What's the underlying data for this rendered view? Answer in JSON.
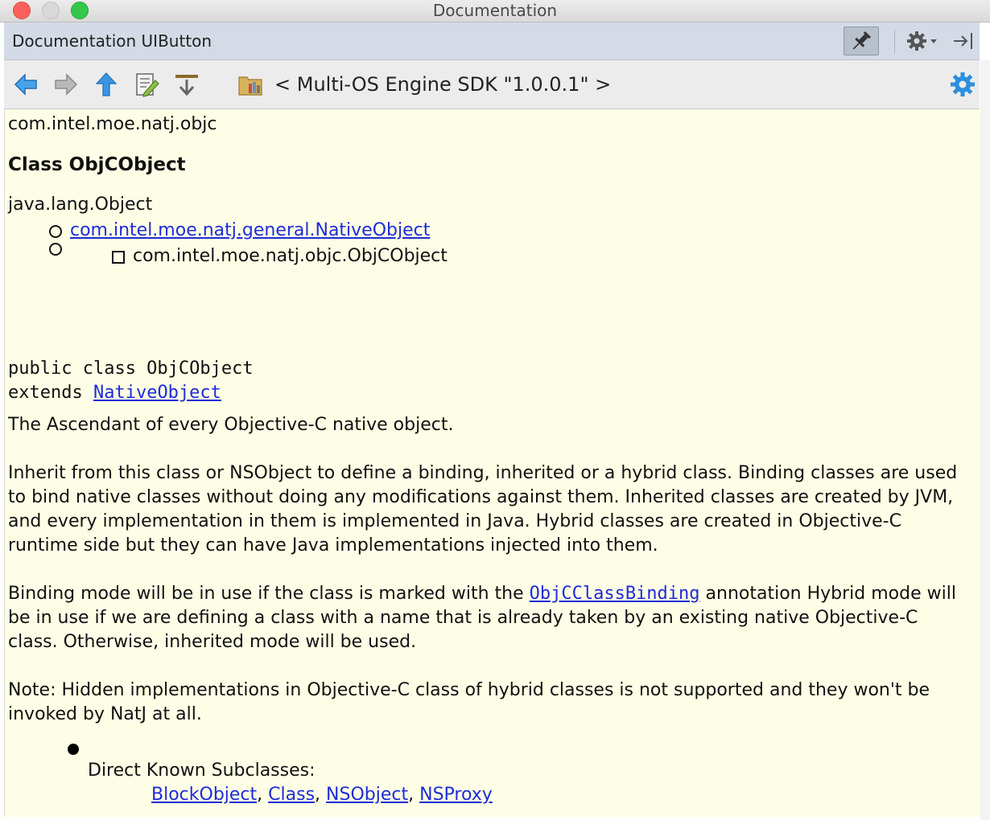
{
  "window": {
    "title": "Documentation"
  },
  "header": {
    "title": "Documentation UIButton",
    "pin_icon": "pin-icon",
    "gear_icon": "gear-icon",
    "hide_icon": "hide-panel-icon"
  },
  "toolbar": {
    "icons": [
      "back-arrow-icon",
      "forward-arrow-icon",
      "up-arrow-icon",
      "edit-source-icon",
      "external-doc-icon",
      "library-icon",
      "settings-gear-icon"
    ],
    "breadcrumb": "< Multi-OS Engine SDK \"1.0.0.1\" >"
  },
  "doc": {
    "package": "com.intel.moe.natj.objc",
    "class_heading": "Class ObjCObject",
    "hierarchy": {
      "root": "java.lang.Object",
      "parent_link": "com.intel.moe.natj.general.NativeObject",
      "current": "com.intel.moe.natj.objc.ObjCObject"
    },
    "signature": {
      "declaration": "public class ObjCObject",
      "extends_prefix": "extends ",
      "extends_link": "NativeObject"
    },
    "summary": "The Ascendant of every Objective-C native object.",
    "para1": "Inherit from this class or NSObject to define a binding, inherited or a hybrid class. Binding classes are used to bind native classes without doing any modifications against them. Inherited classes are created by JVM, and every implementation in them is implemented in Java. Hybrid classes are created in Objective-C runtime side but they can have Java implementations injected into them.",
    "para2": {
      "before": "Binding mode will be in use if the class is marked with the ",
      "link": "ObjCClassBinding",
      "after": " annotation Hybrid mode will be in use if we are defining a class with a name that is already taken by an existing native Objective-C class. Otherwise, inherited mode will be used."
    },
    "para3": "Note: Hidden implementations in Objective-C class of hybrid classes is not supported and they won't be invoked by NatJ at all.",
    "subclasses": {
      "label": "Direct Known Subclasses:",
      "links": [
        "BlockObject",
        "Class",
        "NSObject",
        "NSProxy"
      ],
      "separator": ", "
    }
  },
  "colors": {
    "content_bg": "#fefee6",
    "link": "#1f2cd8",
    "header_bg": "#d4dbe6",
    "accent_blue": "#2b8fe0"
  }
}
